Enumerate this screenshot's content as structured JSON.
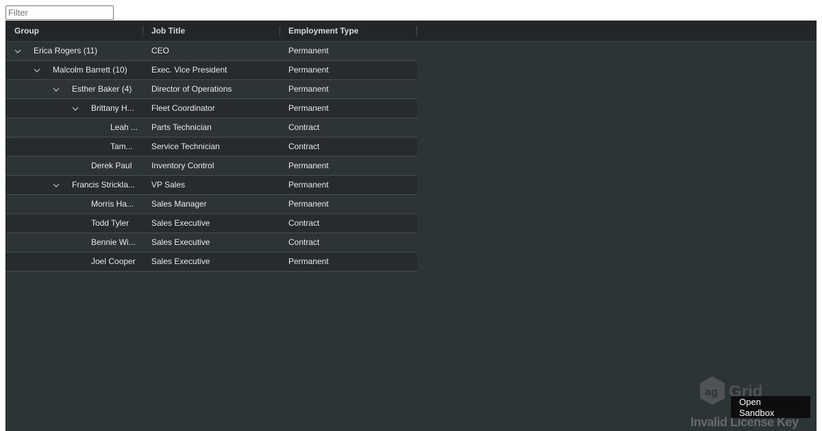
{
  "filter": {
    "placeholder": "Filter",
    "value": ""
  },
  "columns": [
    "Group",
    "Job Title",
    "Employment Type"
  ],
  "rows": [
    {
      "level": 0,
      "expandable": true,
      "group": "Erica Rogers (11)",
      "job": "CEO",
      "type": "Permanent"
    },
    {
      "level": 1,
      "expandable": true,
      "group": "Malcolm Barrett (10)",
      "job": "Exec. Vice President",
      "type": "Permanent"
    },
    {
      "level": 2,
      "expandable": true,
      "group": "Esther Baker (4)",
      "job": "Director of Operations",
      "type": "Permanent"
    },
    {
      "level": 3,
      "expandable": true,
      "group": "Brittany H...",
      "job": "Fleet Coordinator",
      "type": "Permanent"
    },
    {
      "level": 4,
      "expandable": false,
      "group": "Leah ...",
      "job": "Parts Technician",
      "type": "Contract"
    },
    {
      "level": 4,
      "expandable": false,
      "group": "Tam...",
      "job": "Service Technician",
      "type": "Contract"
    },
    {
      "level": 3,
      "expandable": false,
      "group": "Derek Paul",
      "job": "Inventory Control",
      "type": "Permanent"
    },
    {
      "level": 2,
      "expandable": true,
      "group": "Francis Strickla...",
      "job": "VP Sales",
      "type": "Permanent"
    },
    {
      "level": 3,
      "expandable": false,
      "group": "Morris Ha...",
      "job": "Sales Manager",
      "type": "Permanent"
    },
    {
      "level": 3,
      "expandable": false,
      "group": "Todd Tyler",
      "job": "Sales Executive",
      "type": "Contract"
    },
    {
      "level": 3,
      "expandable": false,
      "group": "Bennie Wi...",
      "job": "Sales Executive",
      "type": "Contract"
    },
    {
      "level": 3,
      "expandable": false,
      "group": "Joel Cooper",
      "job": "Sales Executive",
      "type": "Permanent"
    }
  ],
  "watermark": {
    "logo_text": "Grid",
    "license_text": "Invalid License Key"
  },
  "popup": {
    "line1": "Open",
    "line2": "Sandbox"
  },
  "colors": {
    "grid_bg": "#2d3436",
    "header_bg": "#222628",
    "text": "#e8eaeb"
  }
}
